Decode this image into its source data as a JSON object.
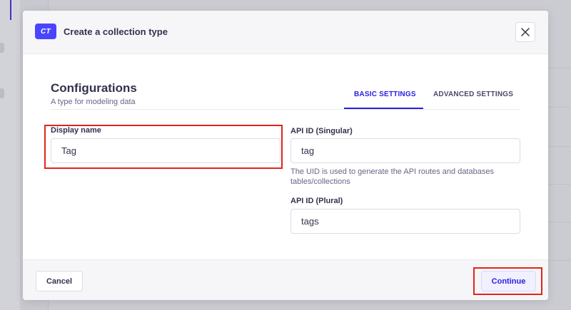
{
  "modal": {
    "badge": "CT",
    "title": "Create a collection type",
    "close_icon": "close-icon"
  },
  "config": {
    "title": "Configurations",
    "subtitle": "A type for modeling data"
  },
  "tabs": [
    {
      "label": "BASIC SETTINGS",
      "active": true
    },
    {
      "label": "ADVANCED SETTINGS",
      "active": false
    }
  ],
  "fields": {
    "display_name": {
      "label": "Display name",
      "value": "Tag"
    },
    "api_singular": {
      "label": "API ID (Singular)",
      "value": "tag",
      "hint": "The UID is used to generate the API routes and databases tables/collections"
    },
    "api_plural": {
      "label": "API ID (Plural)",
      "value": "tags"
    }
  },
  "footer": {
    "cancel_label": "Cancel",
    "continue_label": "Continue"
  },
  "colors": {
    "primary": "#4945ff",
    "active_tab": "#271fe0",
    "highlight": "#e0251b"
  }
}
